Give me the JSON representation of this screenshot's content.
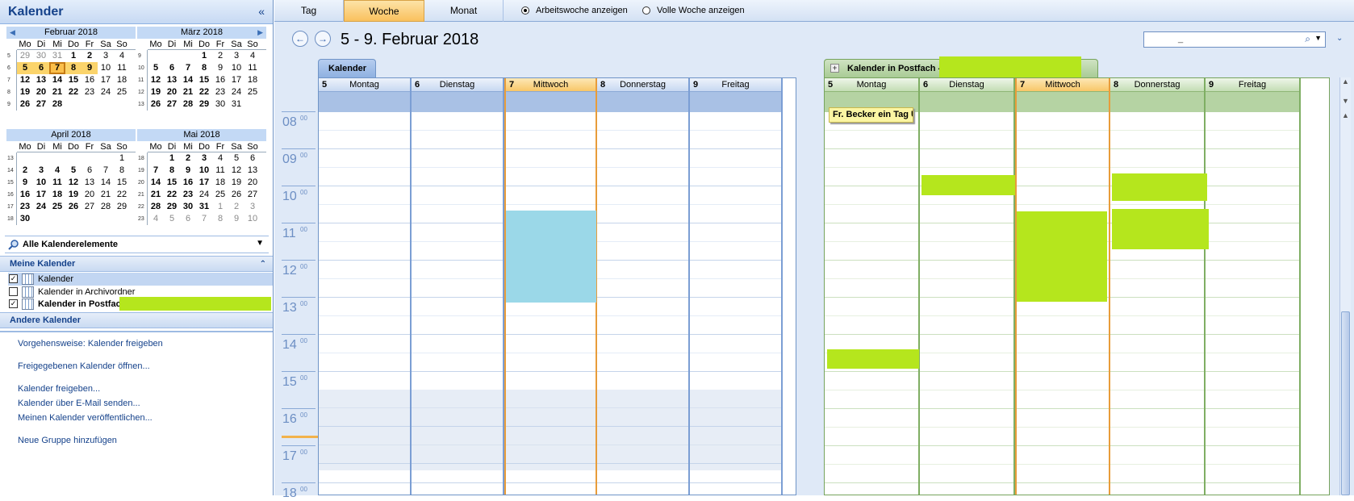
{
  "nav": {
    "title": "Kalender",
    "collapse_glyph": "«",
    "months": [
      {
        "name": "Februar 2018",
        "rows": [
          {
            "wk": "5",
            "days": [
              {
                "t": "29",
                "o": 1
              },
              {
                "t": "30",
                "o": 1
              },
              {
                "t": "31",
                "o": 1
              },
              {
                "t": "1",
                "b": 1
              },
              {
                "t": "2",
                "b": 1
              },
              {
                "t": "3"
              },
              {
                "t": "4"
              }
            ]
          },
          {
            "wk": "6",
            "days": [
              {
                "t": "5",
                "b": 1,
                "s": 1
              },
              {
                "t": "6",
                "b": 1,
                "s": 1
              },
              {
                "t": "7",
                "b": 1,
                "today": 1
              },
              {
                "t": "8",
                "b": 1,
                "s": 1
              },
              {
                "t": "9",
                "b": 1,
                "s": 1
              },
              {
                "t": "10"
              },
              {
                "t": "11"
              }
            ]
          },
          {
            "wk": "7",
            "days": [
              {
                "t": "12",
                "b": 1
              },
              {
                "t": "13",
                "b": 1
              },
              {
                "t": "14",
                "b": 1
              },
              {
                "t": "15",
                "b": 1
              },
              {
                "t": "16"
              },
              {
                "t": "17"
              },
              {
                "t": "18"
              }
            ]
          },
          {
            "wk": "8",
            "days": [
              {
                "t": "19",
                "b": 1
              },
              {
                "t": "20",
                "b": 1
              },
              {
                "t": "21",
                "b": 1
              },
              {
                "t": "22",
                "b": 1
              },
              {
                "t": "23"
              },
              {
                "t": "24"
              },
              {
                "t": "25"
              }
            ]
          },
          {
            "wk": "9",
            "days": [
              {
                "t": "26",
                "b": 1
              },
              {
                "t": "27",
                "b": 1
              },
              {
                "t": "28",
                "b": 1
              },
              {
                "t": ""
              },
              {
                "t": ""
              },
              {
                "t": ""
              },
              {
                "t": ""
              }
            ]
          }
        ]
      },
      {
        "name": "März 2018",
        "rows": [
          {
            "wk": "9",
            "days": [
              {
                "t": ""
              },
              {
                "t": ""
              },
              {
                "t": ""
              },
              {
                "t": "1",
                "b": 1
              },
              {
                "t": "2"
              },
              {
                "t": "3"
              },
              {
                "t": "4"
              }
            ]
          },
          {
            "wk": "10",
            "days": [
              {
                "t": "5",
                "b": 1
              },
              {
                "t": "6",
                "b": 1
              },
              {
                "t": "7",
                "b": 1
              },
              {
                "t": "8",
                "b": 1
              },
              {
                "t": "9"
              },
              {
                "t": "10"
              },
              {
                "t": "11"
              }
            ]
          },
          {
            "wk": "11",
            "days": [
              {
                "t": "12",
                "b": 1
              },
              {
                "t": "13",
                "b": 1
              },
              {
                "t": "14",
                "b": 1
              },
              {
                "t": "15",
                "b": 1
              },
              {
                "t": "16"
              },
              {
                "t": "17"
              },
              {
                "t": "18"
              }
            ]
          },
          {
            "wk": "12",
            "days": [
              {
                "t": "19",
                "b": 1
              },
              {
                "t": "20",
                "b": 1
              },
              {
                "t": "21",
                "b": 1
              },
              {
                "t": "22",
                "b": 1
              },
              {
                "t": "23"
              },
              {
                "t": "24"
              },
              {
                "t": "25"
              }
            ]
          },
          {
            "wk": "13",
            "days": [
              {
                "t": "26",
                "b": 1
              },
              {
                "t": "27",
                "b": 1
              },
              {
                "t": "28",
                "b": 1
              },
              {
                "t": "29",
                "b": 1
              },
              {
                "t": "30"
              },
              {
                "t": "31"
              },
              {
                "t": ""
              }
            ]
          }
        ]
      },
      {
        "name": "April 2018",
        "rows": [
          {
            "wk": "13",
            "days": [
              {
                "t": ""
              },
              {
                "t": ""
              },
              {
                "t": ""
              },
              {
                "t": ""
              },
              {
                "t": ""
              },
              {
                "t": ""
              },
              {
                "t": "1"
              }
            ]
          },
          {
            "wk": "14",
            "days": [
              {
                "t": "2",
                "b": 1
              },
              {
                "t": "3",
                "b": 1
              },
              {
                "t": "4",
                "b": 1
              },
              {
                "t": "5",
                "b": 1
              },
              {
                "t": "6"
              },
              {
                "t": "7"
              },
              {
                "t": "8"
              }
            ]
          },
          {
            "wk": "15",
            "days": [
              {
                "t": "9",
                "b": 1
              },
              {
                "t": "10",
                "b": 1
              },
              {
                "t": "11",
                "b": 1
              },
              {
                "t": "12",
                "b": 1
              },
              {
                "t": "13"
              },
              {
                "t": "14"
              },
              {
                "t": "15"
              }
            ]
          },
          {
            "wk": "16",
            "days": [
              {
                "t": "16",
                "b": 1
              },
              {
                "t": "17",
                "b": 1
              },
              {
                "t": "18",
                "b": 1
              },
              {
                "t": "19",
                "b": 1
              },
              {
                "t": "20"
              },
              {
                "t": "21"
              },
              {
                "t": "22"
              }
            ]
          },
          {
            "wk": "17",
            "days": [
              {
                "t": "23",
                "b": 1
              },
              {
                "t": "24",
                "b": 1
              },
              {
                "t": "25",
                "b": 1
              },
              {
                "t": "26",
                "b": 1
              },
              {
                "t": "27"
              },
              {
                "t": "28"
              },
              {
                "t": "29"
              }
            ]
          },
          {
            "wk": "18",
            "days": [
              {
                "t": "30",
                "b": 1
              },
              {
                "t": ""
              },
              {
                "t": ""
              },
              {
                "t": ""
              },
              {
                "t": ""
              },
              {
                "t": ""
              },
              {
                "t": ""
              }
            ]
          }
        ]
      },
      {
        "name": "Mai 2018",
        "rows": [
          {
            "wk": "18",
            "days": [
              {
                "t": ""
              },
              {
                "t": "1",
                "b": 1
              },
              {
                "t": "2",
                "b": 1
              },
              {
                "t": "3",
                "b": 1
              },
              {
                "t": "4"
              },
              {
                "t": "5"
              },
              {
                "t": "6"
              }
            ]
          },
          {
            "wk": "19",
            "days": [
              {
                "t": "7",
                "b": 1
              },
              {
                "t": "8",
                "b": 1
              },
              {
                "t": "9",
                "b": 1
              },
              {
                "t": "10",
                "b": 1
              },
              {
                "t": "11"
              },
              {
                "t": "12"
              },
              {
                "t": "13"
              }
            ]
          },
          {
            "wk": "20",
            "days": [
              {
                "t": "14",
                "b": 1
              },
              {
                "t": "15",
                "b": 1
              },
              {
                "t": "16",
                "b": 1
              },
              {
                "t": "17",
                "b": 1
              },
              {
                "t": "18"
              },
              {
                "t": "19"
              },
              {
                "t": "20"
              }
            ]
          },
          {
            "wk": "21",
            "days": [
              {
                "t": "21",
                "b": 1
              },
              {
                "t": "22",
                "b": 1
              },
              {
                "t": "23",
                "b": 1
              },
              {
                "t": "24"
              },
              {
                "t": "25"
              },
              {
                "t": "26"
              },
              {
                "t": "27"
              }
            ]
          },
          {
            "wk": "22",
            "days": [
              {
                "t": "28",
                "b": 1
              },
              {
                "t": "29",
                "b": 1
              },
              {
                "t": "30",
                "b": 1
              },
              {
                "t": "31",
                "b": 1
              },
              {
                "t": "1",
                "o": 1
              },
              {
                "t": "2",
                "o": 1
              },
              {
                "t": "3",
                "o": 1
              }
            ]
          },
          {
            "wk": "23",
            "days": [
              {
                "t": "4",
                "o": 1
              },
              {
                "t": "5",
                "o": 1
              },
              {
                "t": "6",
                "o": 1
              },
              {
                "t": "7",
                "o": 1
              },
              {
                "t": "8",
                "o": 1
              },
              {
                "t": "9",
                "o": 1
              },
              {
                "t": "10",
                "o": 1
              }
            ]
          }
        ]
      }
    ],
    "weekdays": [
      "Mo",
      "Di",
      "Mi",
      "Do",
      "Fr",
      "Sa",
      "So"
    ],
    "filter_label": "Alle Kalenderelemente",
    "my_calendars_header": "Meine Kalender",
    "calendars": [
      {
        "label": "Kalender",
        "checked": true
      },
      {
        "label": "Kalender in Archivordner",
        "checked": false
      },
      {
        "label": "Kalender in Postfach",
        "checked": true
      }
    ],
    "other_calendars_header": "Andere Kalender",
    "links": [
      "Vorgehensweise: Kalender freigeben",
      "Freigegebenen Kalender öffnen...",
      "Kalender freigeben...",
      "Kalender über E-Mail senden...",
      "Meinen Kalender veröffentlichen...",
      "Neue Gruppe hinzufügen"
    ]
  },
  "viewbar": {
    "tabs": [
      "Tag",
      "Woche",
      "Monat"
    ],
    "active_tab": "Woche",
    "radio_workweek": "Arbeitswoche anzeigen",
    "radio_fullweek": "Volle Woche anzeigen"
  },
  "datebar": {
    "range": "5 - 9. Februar 2018",
    "search_placeholder": "_"
  },
  "panes": {
    "tab1": "Kalender",
    "tab2": "Kalender in Postfach -"
  },
  "days": [
    {
      "num": "5",
      "name": "Montag"
    },
    {
      "num": "6",
      "name": "Dienstag"
    },
    {
      "num": "7",
      "name": "Mittwoch"
    },
    {
      "num": "8",
      "name": "Donnerstag"
    },
    {
      "num": "9",
      "name": "Freitag"
    }
  ],
  "hours": [
    "08",
    "09",
    "10",
    "11",
    "12",
    "13",
    "14",
    "15",
    "16",
    "17",
    "18"
  ],
  "hour_suffix": "00",
  "appointment": "Fr. Becker ein Tag Ur",
  "colors": {
    "accent": "#15428b",
    "today": "#f8c668",
    "redaction": "#b5e61d",
    "event_blue": "#9bd8e8"
  }
}
